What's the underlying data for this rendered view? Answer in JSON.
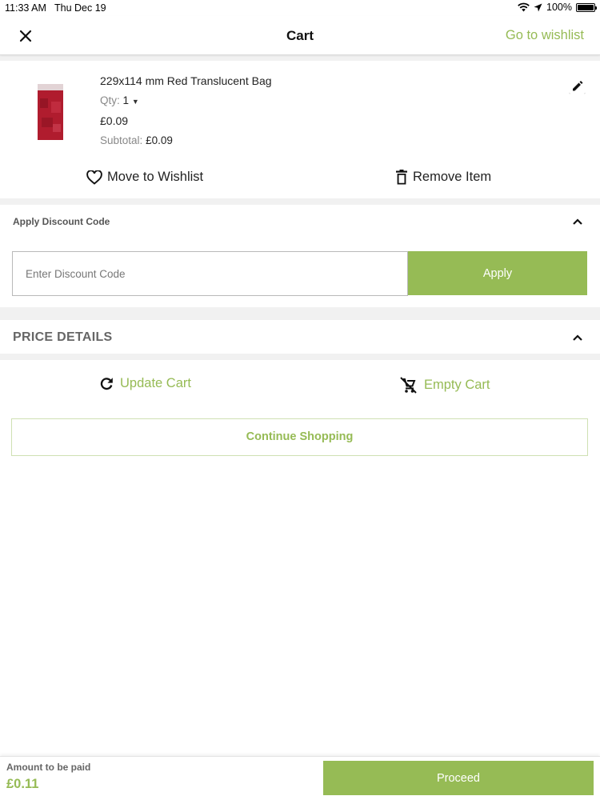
{
  "status_bar": {
    "time": "11:33 AM",
    "date": "Thu Dec 19",
    "battery": "100%"
  },
  "navbar": {
    "title": "Cart",
    "wishlist_link": "Go to wishlist"
  },
  "cart_item": {
    "name": "229x114 mm Red Translucent Bag",
    "qty_label": "Qty:",
    "qty_value": "1",
    "price": "£0.09",
    "subtotal_label": "Subtotal:",
    "subtotal_value": "£0.09",
    "move_to_wishlist": "Move to Wishlist",
    "remove_item": "Remove Item"
  },
  "discount": {
    "heading": "Apply Discount Code",
    "placeholder": "Enter Discount Code",
    "value": "",
    "apply_label": "Apply"
  },
  "price_details": {
    "heading": "PRICE DETAILS"
  },
  "cart_actions": {
    "update_cart": "Update Cart",
    "empty_cart": "Empty Cart",
    "continue_shopping": "Continue Shopping"
  },
  "footer": {
    "amount_label": "Amount to be paid",
    "amount_value": "£0.11",
    "proceed_label": "Proceed"
  },
  "colors": {
    "accent": "#96bb55",
    "background": "#f1f1f1",
    "product": "#b01c2e"
  },
  "icons": {
    "close": "close-icon",
    "edit": "pencil-icon",
    "wishlist": "heart-icon",
    "remove": "trash-icon",
    "collapse": "chevron-up-icon",
    "update": "refresh-icon",
    "empty": "remove-cart-icon"
  }
}
